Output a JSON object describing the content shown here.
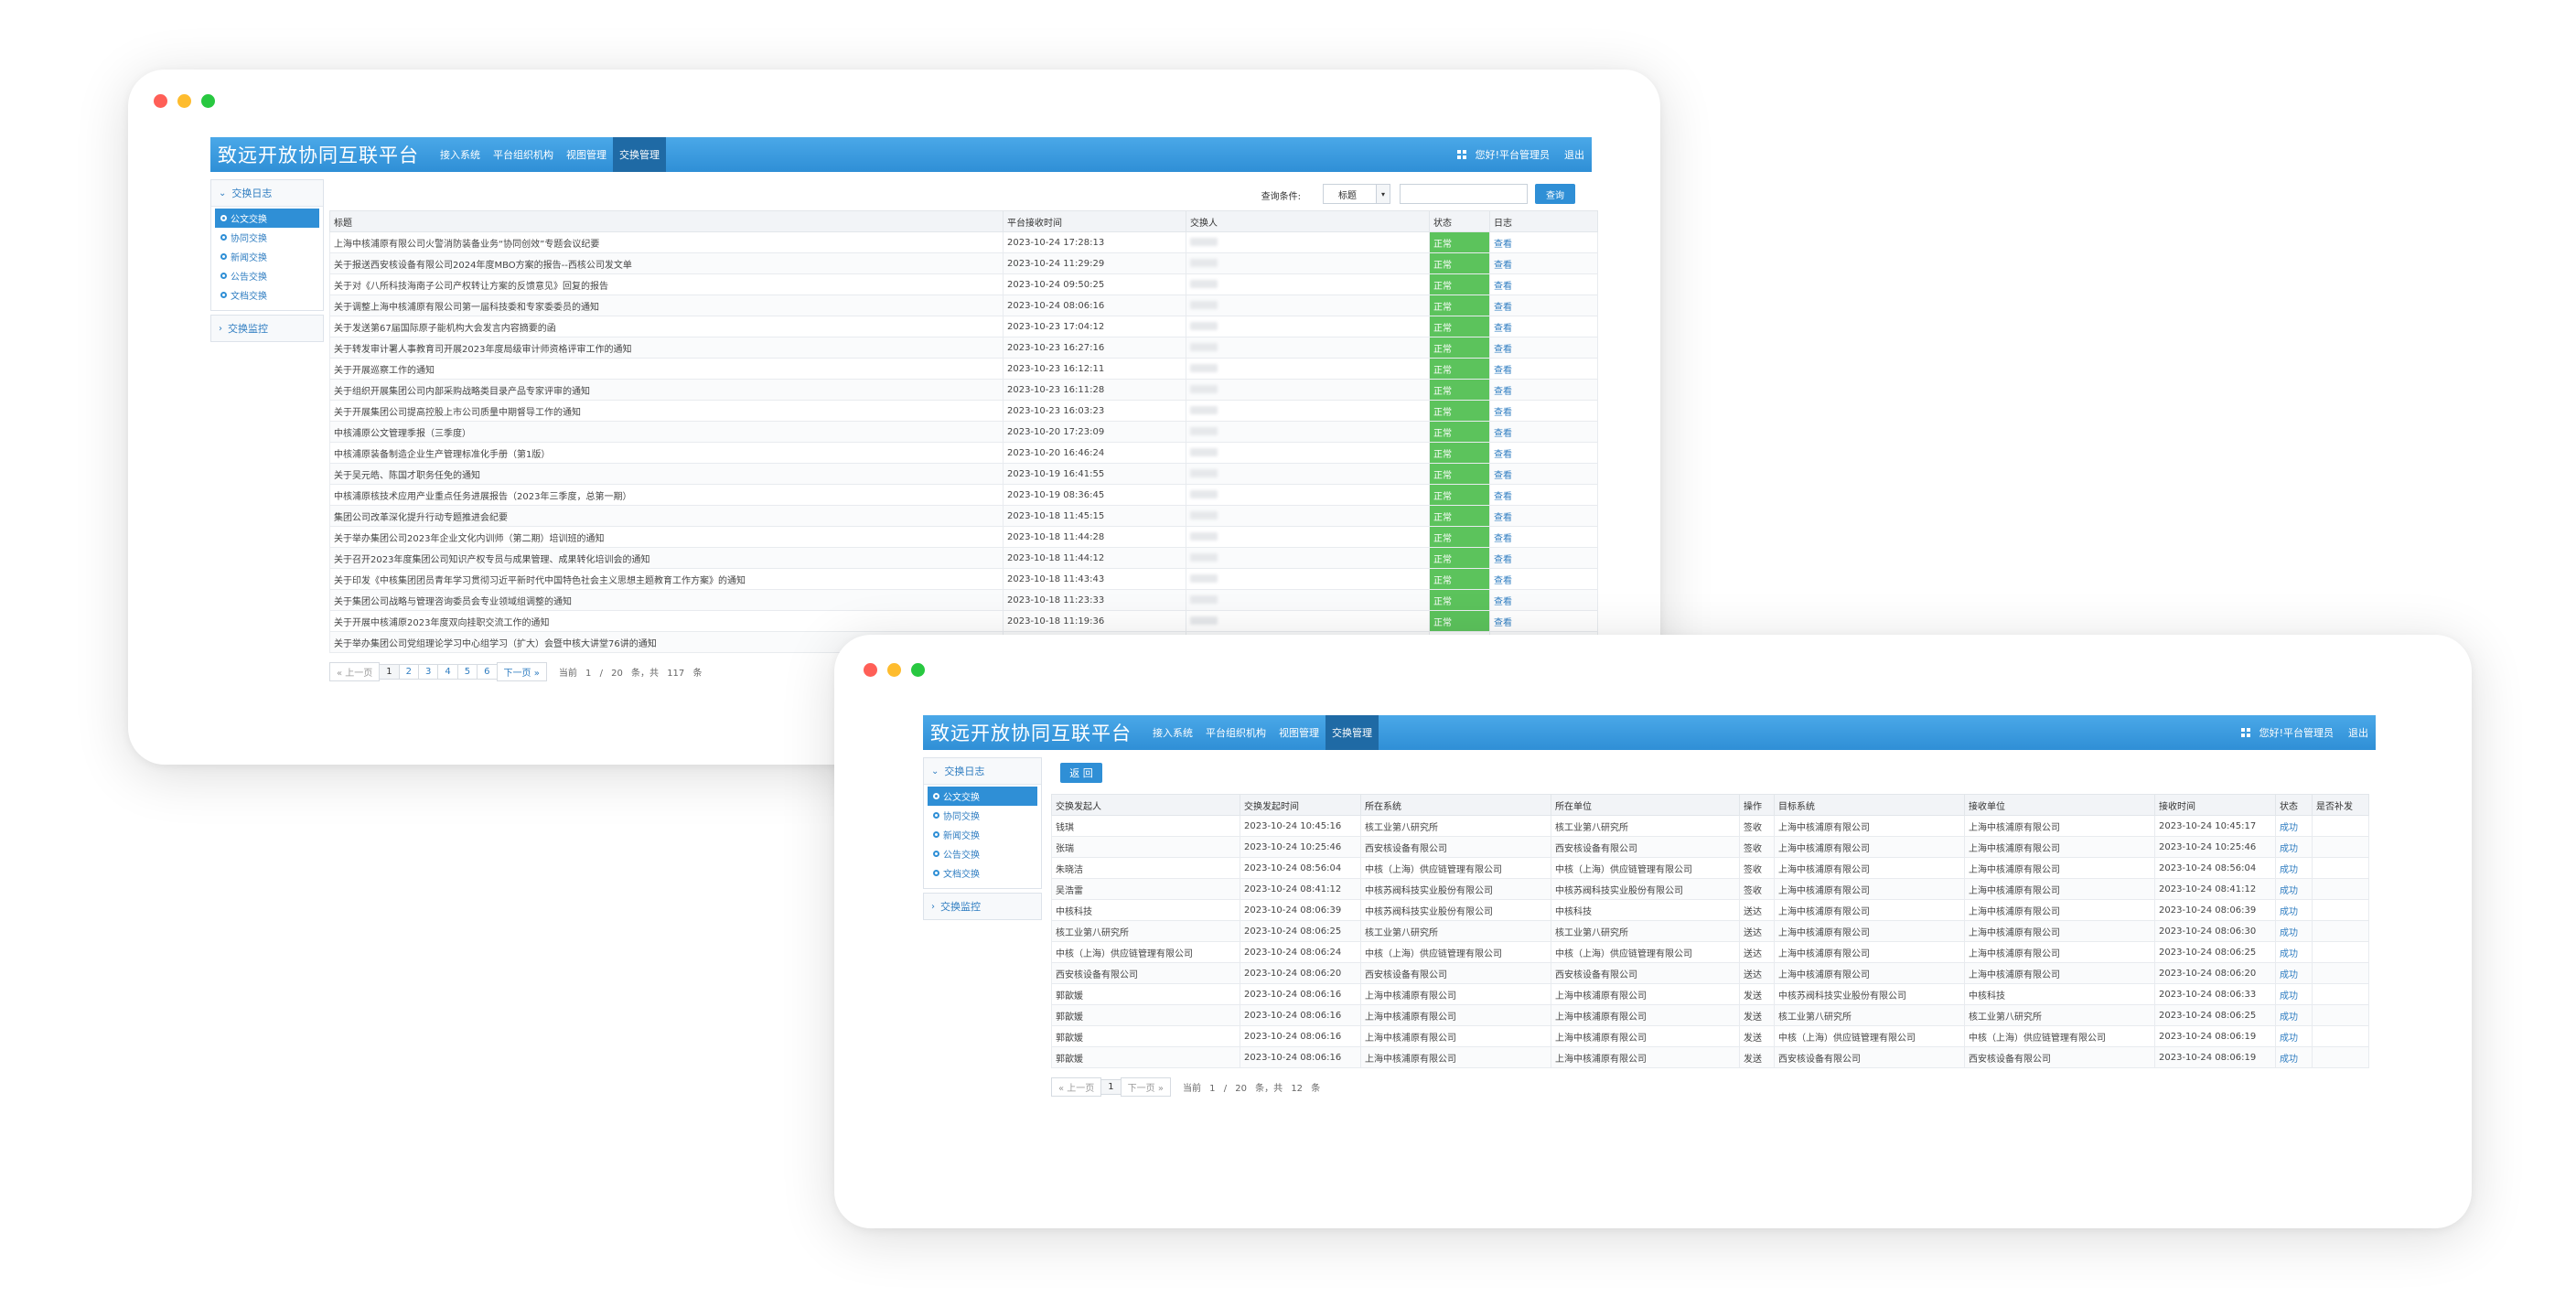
{
  "window1": {
    "brand": "致远开放协同互联平台",
    "nav": [
      "接入系统",
      "平台组织机构",
      "视图管理",
      "交换管理"
    ],
    "user": "您好!平台管理员",
    "logout": "退出",
    "sidebar": {
      "group1": "交换日志",
      "items": [
        "公文交换",
        "协同交换",
        "新闻交换",
        "公告交换",
        "文档交换"
      ],
      "group2": "交换监控"
    },
    "search": {
      "label": "查询条件:",
      "select_value": "标题",
      "button": "查询"
    },
    "columns": [
      "标题",
      "平台接收时间",
      "交换人",
      "状态",
      "日志"
    ],
    "rows": [
      [
        "上海中核浦原有限公司火警消防装备业务“协同创效”专题会议纪要",
        "2023-10-24 17:28:13",
        "正常",
        "查看"
      ],
      [
        "关于报送西安核设备有限公司2024年度MBO方案的报告--西核公司发文单",
        "2023-10-24 11:29:29",
        "正常",
        "查看"
      ],
      [
        "关于对《八所科技海南子公司产权转让方案的反馈意见》回复的报告",
        "2023-10-24 09:50:25",
        "正常",
        "查看"
      ],
      [
        "关于调整上海中核浦原有限公司第一届科技委和专家委委员的通知",
        "2023-10-24 08:06:16",
        "正常",
        "查看"
      ],
      [
        "关于发送第67届国际原子能机构大会发言内容摘要的函",
        "2023-10-23 17:04:12",
        "正常",
        "查看"
      ],
      [
        "关于转发审计署人事教育司开展2023年度局级审计师资格评审工作的通知",
        "2023-10-23 16:27:16",
        "正常",
        "查看"
      ],
      [
        "关于开展巡察工作的通知",
        "2023-10-23 16:12:11",
        "正常",
        "查看"
      ],
      [
        "关于组织开展集团公司内部采购战略类目录产品专家评审的通知",
        "2023-10-23 16:11:28",
        "正常",
        "查看"
      ],
      [
        "关于开展集团公司提高控股上市公司质量中期督导工作的通知",
        "2023-10-23 16:03:23",
        "正常",
        "查看"
      ],
      [
        "中核浦原公文管理季报（三季度）",
        "2023-10-20 17:23:09",
        "正常",
        "查看"
      ],
      [
        "中核浦原装备制造企业生产管理标准化手册（第1版）",
        "2023-10-20 16:46:24",
        "正常",
        "查看"
      ],
      [
        "关于吴元皓、陈国才职务任免的通知",
        "2023-10-19 16:41:55",
        "正常",
        "查看"
      ],
      [
        "中核浦原核技术应用产业重点任务进展报告（2023年三季度，总第一期）",
        "2023-10-19 08:36:45",
        "正常",
        "查看"
      ],
      [
        "集团公司改革深化提升行动专题推进会纪要",
        "2023-10-18 11:45:15",
        "正常",
        "查看"
      ],
      [
        "关于举办集团公司2023年企业文化内训师（第二期）培训班的通知",
        "2023-10-18 11:44:28",
        "正常",
        "查看"
      ],
      [
        "关于召开2023年度集团公司知识产权专员与成果管理、成果转化培训会的通知",
        "2023-10-18 11:44:12",
        "正常",
        "查看"
      ],
      [
        "关于印发《中核集团团员青年学习贯彻习近平新时代中国特色社会主义思想主题教育工作方案》的通知",
        "2023-10-18 11:43:43",
        "正常",
        "查看"
      ],
      [
        "关于集团公司战略与管理咨询委员会专业领域组调整的通知",
        "2023-10-18 11:23:33",
        "正常",
        "查看"
      ],
      [
        "关于开展中核浦原2023年度双向挂职交流工作的通知",
        "2023-10-18 11:19:36",
        "正常",
        "查看"
      ],
      [
        "关于举办集团公司党组理论学习中心组学习（扩大）会暨中核大讲堂76讲的通知",
        "",
        "",
        ""
      ]
    ],
    "pager": {
      "prev": "« 上一页",
      "pages": [
        "1",
        "2",
        "3",
        "4",
        "5",
        "6"
      ],
      "next": "下一页 »",
      "info": "当前 1 / 20 条，共 117 条"
    }
  },
  "window2": {
    "brand": "致远开放协同互联平台",
    "nav": [
      "接入系统",
      "平台组织机构",
      "视图管理",
      "交换管理"
    ],
    "user": "您好!平台管理员",
    "logout": "退出",
    "sidebar": {
      "group1": "交换日志",
      "items": [
        "公文交换",
        "协同交换",
        "新闻交换",
        "公告交换",
        "文档交换"
      ],
      "group2": "交换监控"
    },
    "back": "返 回",
    "columns": [
      "交换发起人",
      "交换发起时间",
      "所在系统",
      "所在单位",
      "操作",
      "目标系统",
      "接收单位",
      "接收时间",
      "状态",
      "是否补发"
    ],
    "rows": [
      [
        "钱琪",
        "2023-10-24 10:45:16",
        "核工业第八研究所",
        "核工业第八研究所",
        "签收",
        "上海中核浦原有限公司",
        "上海中核浦原有限公司",
        "2023-10-24 10:45:17",
        "成功",
        ""
      ],
      [
        "张瑞",
        "2023-10-24 10:25:46",
        "西安核设备有限公司",
        "西安核设备有限公司",
        "签收",
        "上海中核浦原有限公司",
        "上海中核浦原有限公司",
        "2023-10-24 10:25:46",
        "成功",
        ""
      ],
      [
        "朱晓洁",
        "2023-10-24 08:56:04",
        "中核（上海）供应链管理有限公司",
        "中核（上海）供应链管理有限公司",
        "签收",
        "上海中核浦原有限公司",
        "上海中核浦原有限公司",
        "2023-10-24 08:56:04",
        "成功",
        ""
      ],
      [
        "吴浩雷",
        "2023-10-24 08:41:12",
        "中核苏阀科技实业股份有限公司",
        "中核苏阀科技实业股份有限公司",
        "签收",
        "上海中核浦原有限公司",
        "上海中核浦原有限公司",
        "2023-10-24 08:41:12",
        "成功",
        ""
      ],
      [
        "中核科技",
        "2023-10-24 08:06:39",
        "中核苏阀科技实业股份有限公司",
        "中核科技",
        "送达",
        "上海中核浦原有限公司",
        "上海中核浦原有限公司",
        "2023-10-24 08:06:39",
        "成功",
        ""
      ],
      [
        "核工业第八研究所",
        "2023-10-24 08:06:25",
        "核工业第八研究所",
        "核工业第八研究所",
        "送达",
        "上海中核浦原有限公司",
        "上海中核浦原有限公司",
        "2023-10-24 08:06:30",
        "成功",
        ""
      ],
      [
        "中核（上海）供应链管理有限公司",
        "2023-10-24 08:06:24",
        "中核（上海）供应链管理有限公司",
        "中核（上海）供应链管理有限公司",
        "送达",
        "上海中核浦原有限公司",
        "上海中核浦原有限公司",
        "2023-10-24 08:06:25",
        "成功",
        ""
      ],
      [
        "西安核设备有限公司",
        "2023-10-24 08:06:20",
        "西安核设备有限公司",
        "西安核设备有限公司",
        "送达",
        "上海中核浦原有限公司",
        "上海中核浦原有限公司",
        "2023-10-24 08:06:20",
        "成功",
        ""
      ],
      [
        "郭歆媛",
        "2023-10-24 08:06:16",
        "上海中核浦原有限公司",
        "上海中核浦原有限公司",
        "发送",
        "中核苏阀科技实业股份有限公司",
        "中核科技",
        "2023-10-24 08:06:33",
        "成功",
        ""
      ],
      [
        "郭歆媛",
        "2023-10-24 08:06:16",
        "上海中核浦原有限公司",
        "上海中核浦原有限公司",
        "发送",
        "核工业第八研究所",
        "核工业第八研究所",
        "2023-10-24 08:06:25",
        "成功",
        ""
      ],
      [
        "郭歆媛",
        "2023-10-24 08:06:16",
        "上海中核浦原有限公司",
        "上海中核浦原有限公司",
        "发送",
        "中核（上海）供应链管理有限公司",
        "中核（上海）供应链管理有限公司",
        "2023-10-24 08:06:19",
        "成功",
        ""
      ],
      [
        "郭歆媛",
        "2023-10-24 08:06:16",
        "上海中核浦原有限公司",
        "上海中核浦原有限公司",
        "发送",
        "西安核设备有限公司",
        "西安核设备有限公司",
        "2023-10-24 08:06:19",
        "成功",
        ""
      ]
    ],
    "pager": {
      "prev": "« 上一页",
      "pages": [
        "1"
      ],
      "next": "下一页 »",
      "info": "当前 1 / 20 条，共 12 条"
    }
  },
  "colors": {
    "header": "#2f8fd6",
    "nav_active": "#1f6aa5",
    "status_ok": "#5cc35c",
    "link": "#2f7dc1"
  },
  "icons": [
    "grid-icon",
    "chevron-down-icon",
    "chevron-right-icon",
    "bullet-icon"
  ]
}
